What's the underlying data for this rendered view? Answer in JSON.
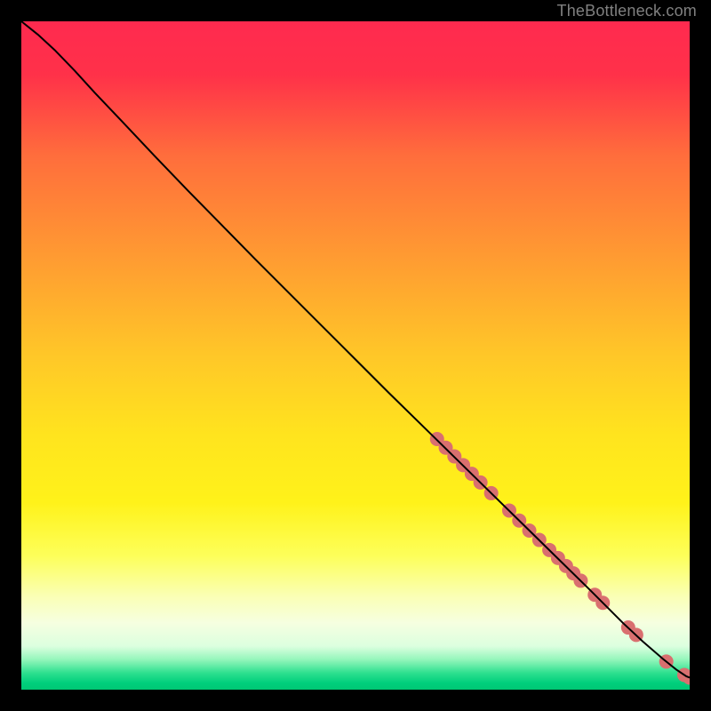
{
  "attribution": "TheBottleneck.com",
  "chart_data": {
    "type": "line",
    "title": "",
    "xlabel": "",
    "ylabel": "",
    "xlim": [
      0,
      1
    ],
    "ylim": [
      0,
      1
    ],
    "background_gradient": {
      "stops": [
        {
          "pos": 0.0,
          "color": "#ff2a4f"
        },
        {
          "pos": 0.08,
          "color": "#ff3149"
        },
        {
          "pos": 0.2,
          "color": "#ff6d3c"
        },
        {
          "pos": 0.35,
          "color": "#ff9a32"
        },
        {
          "pos": 0.5,
          "color": "#ffc728"
        },
        {
          "pos": 0.62,
          "color": "#ffe41e"
        },
        {
          "pos": 0.72,
          "color": "#fff21a"
        },
        {
          "pos": 0.8,
          "color": "#fdff5a"
        },
        {
          "pos": 0.86,
          "color": "#faffb5"
        },
        {
          "pos": 0.9,
          "color": "#f6ffe0"
        },
        {
          "pos": 0.935,
          "color": "#dcffdf"
        },
        {
          "pos": 0.955,
          "color": "#94f6bb"
        },
        {
          "pos": 0.975,
          "color": "#2de08f"
        },
        {
          "pos": 0.99,
          "color": "#00cf7c"
        },
        {
          "pos": 1.0,
          "color": "#00c774"
        }
      ]
    },
    "series": [
      {
        "name": "curve",
        "type": "line",
        "color": "#000000",
        "points": [
          {
            "x": 0.0,
            "y": 1.0
          },
          {
            "x": 0.025,
            "y": 0.98
          },
          {
            "x": 0.05,
            "y": 0.957
          },
          {
            "x": 0.08,
            "y": 0.926
          },
          {
            "x": 0.11,
            "y": 0.893
          },
          {
            "x": 0.15,
            "y": 0.851
          },
          {
            "x": 0.2,
            "y": 0.798
          },
          {
            "x": 0.25,
            "y": 0.746
          },
          {
            "x": 0.3,
            "y": 0.695
          },
          {
            "x": 0.35,
            "y": 0.644
          },
          {
            "x": 0.4,
            "y": 0.594
          },
          {
            "x": 0.45,
            "y": 0.544
          },
          {
            "x": 0.5,
            "y": 0.494
          },
          {
            "x": 0.55,
            "y": 0.444
          },
          {
            "x": 0.6,
            "y": 0.395
          },
          {
            "x": 0.65,
            "y": 0.346
          },
          {
            "x": 0.7,
            "y": 0.297
          },
          {
            "x": 0.75,
            "y": 0.248
          },
          {
            "x": 0.8,
            "y": 0.199
          },
          {
            "x": 0.85,
            "y": 0.15
          },
          {
            "x": 0.9,
            "y": 0.1
          },
          {
            "x": 0.93,
            "y": 0.072
          },
          {
            "x": 0.96,
            "y": 0.046
          },
          {
            "x": 0.98,
            "y": 0.03
          },
          {
            "x": 0.995,
            "y": 0.02
          },
          {
            "x": 1.0,
            "y": 0.018
          }
        ]
      },
      {
        "name": "markers",
        "type": "scatter",
        "color": "#d96f6f",
        "radius": 8,
        "points": [
          {
            "x": 0.622,
            "y": 0.375
          },
          {
            "x": 0.635,
            "y": 0.362
          },
          {
            "x": 0.648,
            "y": 0.349
          },
          {
            "x": 0.661,
            "y": 0.336
          },
          {
            "x": 0.674,
            "y": 0.323
          },
          {
            "x": 0.687,
            "y": 0.31
          },
          {
            "x": 0.703,
            "y": 0.294
          },
          {
            "x": 0.73,
            "y": 0.268
          },
          {
            "x": 0.745,
            "y": 0.253
          },
          {
            "x": 0.76,
            "y": 0.238
          },
          {
            "x": 0.775,
            "y": 0.224
          },
          {
            "x": 0.79,
            "y": 0.209
          },
          {
            "x": 0.803,
            "y": 0.197
          },
          {
            "x": 0.815,
            "y": 0.185
          },
          {
            "x": 0.826,
            "y": 0.174
          },
          {
            "x": 0.837,
            "y": 0.163
          },
          {
            "x": 0.858,
            "y": 0.142
          },
          {
            "x": 0.87,
            "y": 0.13
          },
          {
            "x": 0.908,
            "y": 0.093
          },
          {
            "x": 0.92,
            "y": 0.082
          },
          {
            "x": 0.965,
            "y": 0.042
          },
          {
            "x": 0.992,
            "y": 0.022
          },
          {
            "x": 1.0,
            "y": 0.018
          }
        ]
      }
    ]
  }
}
